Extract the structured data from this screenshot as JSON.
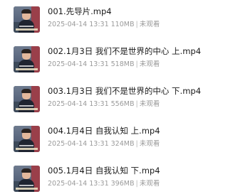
{
  "files": [
    {
      "name": "001.先导片.mp4",
      "date": "2025-04-14 13:31",
      "size": "110MB",
      "status": "未观看",
      "thumbnail_icon": "video-thumbnail"
    },
    {
      "name": "002.1月3日 我们不是世界的中心 上.mp4",
      "date": "2025-04-14 13:31",
      "size": "518MB",
      "status": "未观看",
      "thumbnail_icon": "video-thumbnail"
    },
    {
      "name": "003.1月3日 我们不是世界的中心 下.mp4",
      "date": "2025-04-14 13:31",
      "size": "556MB",
      "status": "未观看",
      "thumbnail_icon": "video-thumbnail"
    },
    {
      "name": "004.1月4日 自我认知 上.mp4",
      "date": "2025-04-14 13:31",
      "size": "324MB",
      "status": "未观看",
      "thumbnail_icon": "video-thumbnail"
    },
    {
      "name": "005.1月4日 自我认知 下.mp4",
      "date": "2025-04-14 13:31",
      "size": "396MB",
      "status": "未观看",
      "thumbnail_icon": "video-thumbnail"
    }
  ],
  "separator": "|"
}
